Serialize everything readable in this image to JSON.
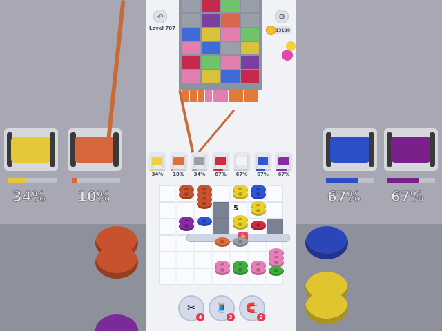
{
  "header": {
    "level_text": "Level 707",
    "coins": "13130",
    "back_icon": "undo-icon",
    "settings_icon": "gear-icon"
  },
  "fabric": {
    "rows": [
      [
        "#9a9ea8",
        "#c5294d",
        "#6fc36b",
        "#9a9ea8"
      ],
      [
        "#9a9ea8",
        "#7b3fa0",
        "#d8684d",
        "#9a9ea8"
      ],
      [
        "#3f6bd6",
        "#d8c23b",
        "#e07fb0",
        "#6fc36b"
      ],
      [
        "#e07fb0",
        "#3f6bd6",
        "#9a9ea8",
        "#d8c23b"
      ],
      [
        "#c5294d",
        "#6fc36b",
        "#e07fb0",
        "#7b3fa0"
      ],
      [
        "#e07fb0",
        "#d8c23b",
        "#3f6bd6",
        "#c5294d"
      ]
    ],
    "fringe": [
      "#e07a3a",
      "#e07a3a",
      "#e07a3a",
      "#e07fb0",
      "#e07fb0",
      "#e07fb0",
      "#e07a3a",
      "#e07a3a",
      "#e07a3a",
      "#e07a3a"
    ]
  },
  "spools": [
    {
      "color": "#f2d23a",
      "pct": "34%",
      "fill": 0.34
    },
    {
      "color": "#e0703a",
      "pct": "10%",
      "fill": 0.1
    },
    {
      "color": "#9a9ea8",
      "pct": "34%",
      "fill": 0.34
    },
    {
      "color": "#d42a3e",
      "pct": "67%",
      "fill": 0.67
    },
    {
      "color": "#f4f4f6",
      "pct": "67%",
      "fill": 0.67
    },
    {
      "color": "#2f55d6",
      "pct": "67%",
      "fill": 0.67
    },
    {
      "color": "#8a2aa8",
      "pct": "67%",
      "fill": 0.67
    }
  ],
  "board": {
    "stack_number": "5",
    "lock_icon": "lock-icon"
  },
  "boosters": [
    {
      "icon": "scissors-icon",
      "count": "4"
    },
    {
      "icon": "spool-icon",
      "count": "3"
    },
    {
      "icon": "magnet-icon",
      "count": "2"
    }
  ],
  "background": {
    "left_pcts": [
      "34%",
      "10%"
    ],
    "right_pcts": [
      "67%",
      "67%"
    ]
  }
}
